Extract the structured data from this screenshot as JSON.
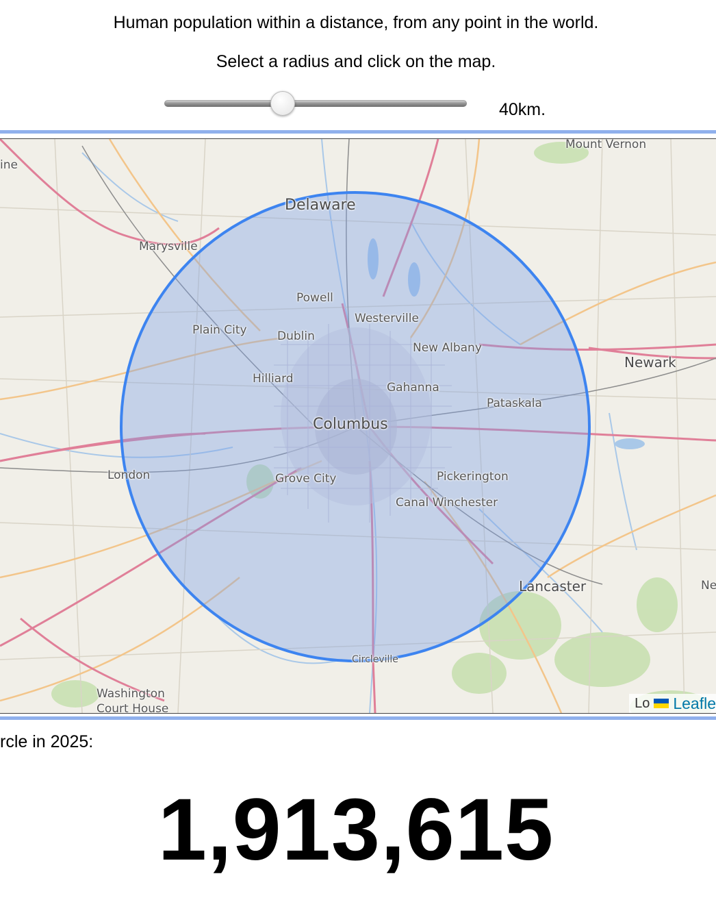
{
  "header": {
    "title": "Human population within a distance, from any point in the world.",
    "subtitle": "Select a radius and click on the map."
  },
  "radius_slider": {
    "value_fraction": 0.39,
    "label": "40km."
  },
  "map": {
    "cities": {
      "delaware": "Delaware",
      "marysville": "Marysville",
      "powell": "Powell",
      "westerville": "Westerville",
      "plain_city": "Plain City",
      "dublin": "Dublin",
      "new_albany": "New Albany",
      "hilliard": "Hilliard",
      "gahanna": "Gahanna",
      "pataskala": "Pataskala",
      "columbus": "Columbus",
      "london": "London",
      "grove_city": "Grove City",
      "pickerington": "Pickerington",
      "canal_winchester": "Canal Winchester",
      "lancaster": "Lancaster",
      "circleville": "Circleville",
      "washington": "Washington Court House",
      "mount_vernon": "Mount Vernon",
      "newark": "Newark",
      "edge_left_top": "ine",
      "edge_right": "Ne"
    },
    "attribution": {
      "prefix": "Lo",
      "leaflet": "Leafle"
    },
    "colors": {
      "circle_stroke": "#3d84f0",
      "circle_fill": "#9bb8ea",
      "highway": "#e78b9d",
      "major_road": "#f3c58a",
      "water": "#a9c8e8",
      "forest": "#bfdca6"
    }
  },
  "result": {
    "caption": "rcle in 2025:",
    "population": "1,913,615"
  }
}
